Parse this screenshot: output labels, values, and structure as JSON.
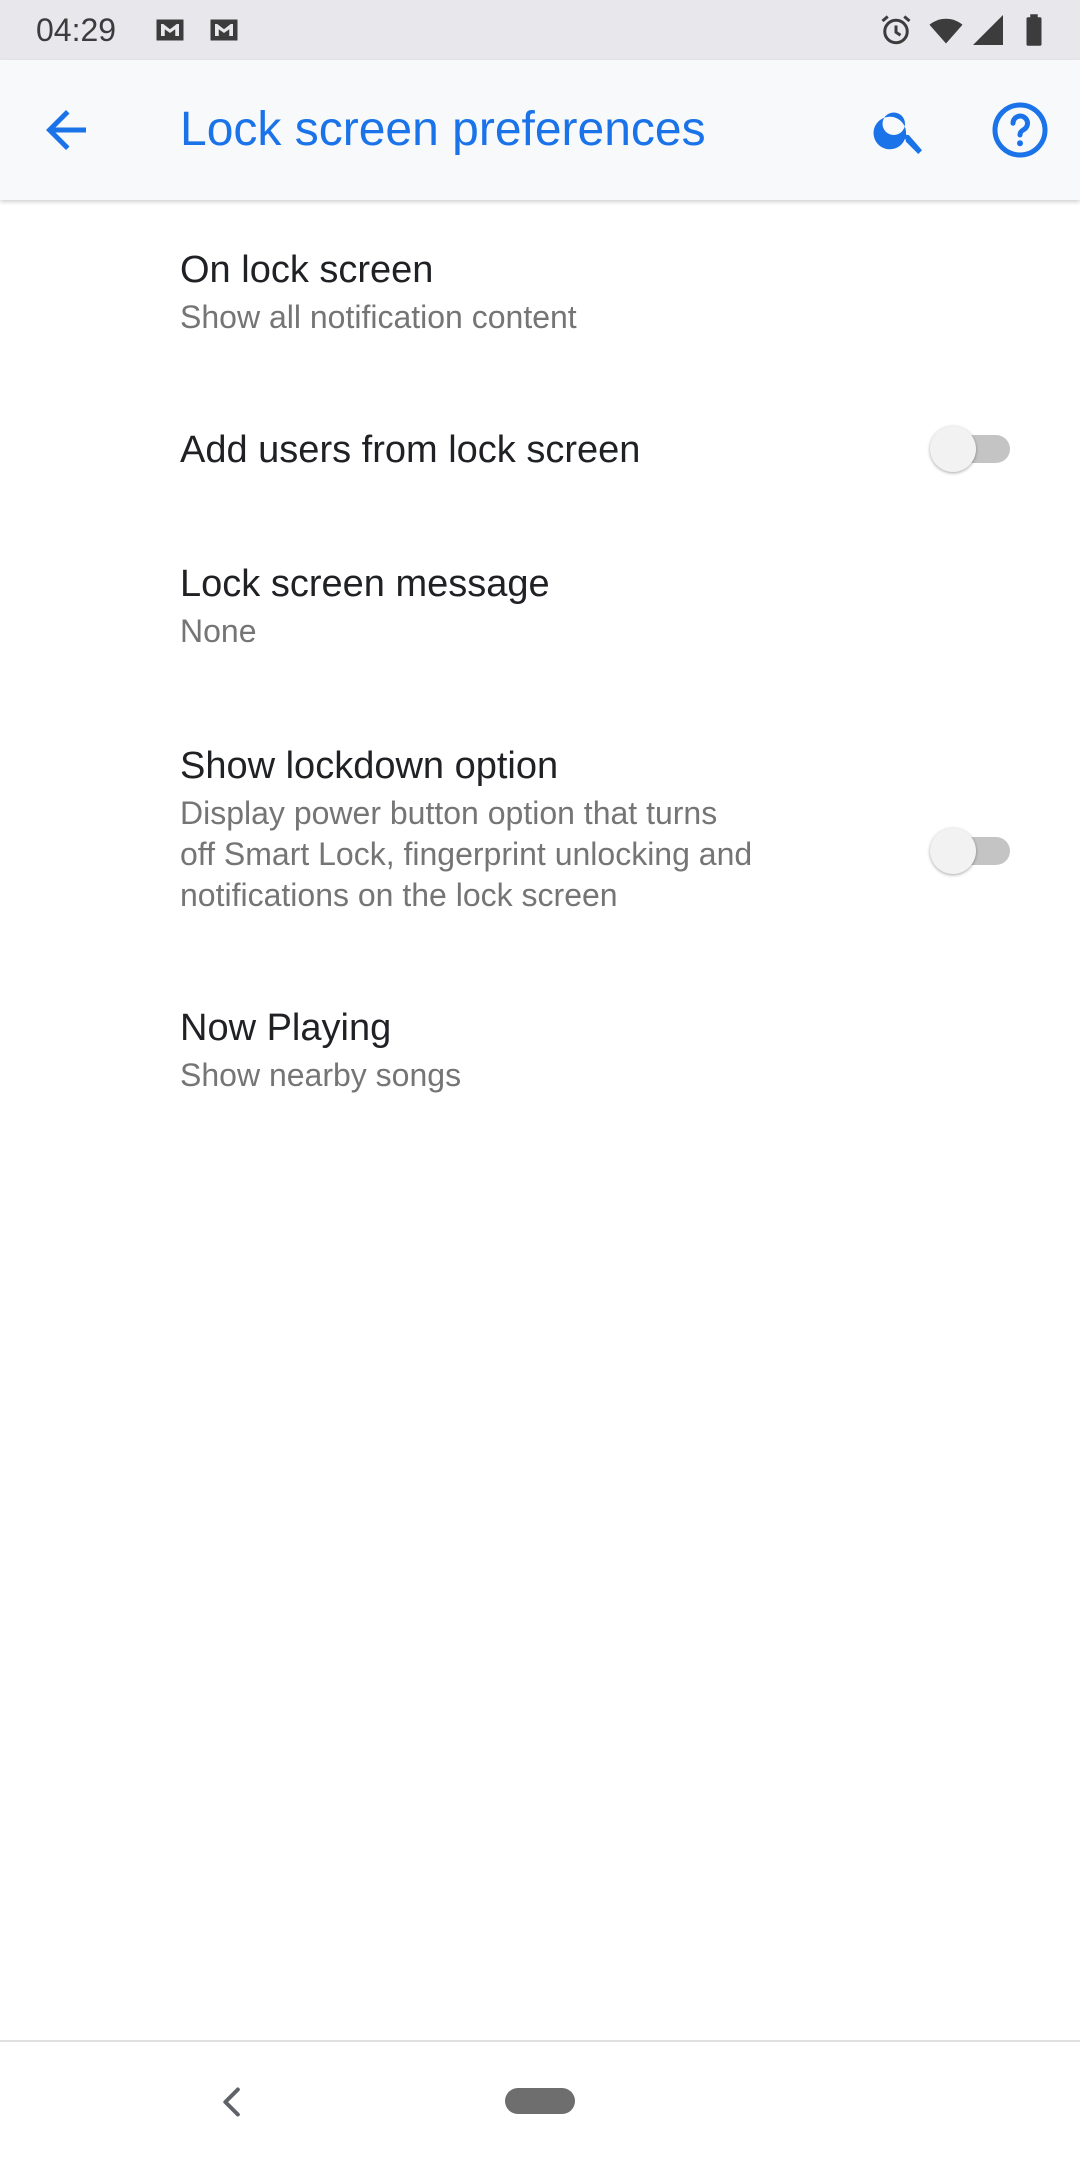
{
  "status_bar": {
    "time": "04:29",
    "left_icons": [
      "gmail-icon",
      "gmail-icon"
    ],
    "right_icons": [
      "alarm-icon",
      "wifi-icon",
      "signal-icon",
      "battery-icon"
    ]
  },
  "app_bar": {
    "title": "Lock screen preferences",
    "back_icon": "arrow-back-icon",
    "search_icon": "search-icon",
    "help_icon": "help-icon",
    "accent_color": "#1a73e8"
  },
  "preferences": [
    {
      "title": "On lock screen",
      "summary": "Show all notification content"
    },
    {
      "title": "Add users from lock screen",
      "switch_on": false
    },
    {
      "title": "Lock screen message",
      "summary": "None"
    },
    {
      "title": "Show lockdown option",
      "summary_lines": [
        "Display power button option that turns",
        "off Smart Lock, fingerprint unlocking and",
        "notifications on the lock screen"
      ],
      "switch_on": false
    },
    {
      "title": "Now Playing",
      "summary": "Show nearby songs"
    }
  ],
  "nav_bar": {
    "back_icon": "nav-back-icon",
    "home_icon": "home-pill-icon"
  }
}
